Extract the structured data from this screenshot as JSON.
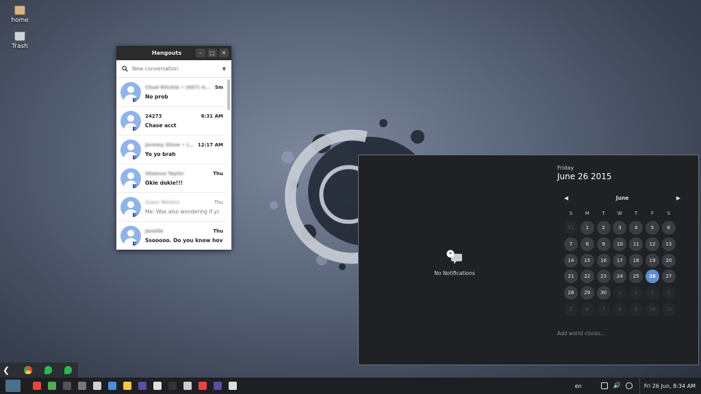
{
  "desktop": {
    "icons": [
      {
        "label": "home",
        "icon": "folder-icon"
      },
      {
        "label": "Trash",
        "icon": "trash-icon"
      }
    ]
  },
  "hangouts": {
    "title": "Hangouts",
    "search_placeholder": "New conversation",
    "conversations": [
      {
        "name": "Chad Ritchie • (607) 4...",
        "time": "5m",
        "message": "No prob",
        "blurred": true,
        "read": false
      },
      {
        "name": "24273",
        "time": "6:31 AM",
        "message": "Chase acct",
        "blurred": false,
        "read": false
      },
      {
        "name": "Jeremy Shaw • (6...",
        "time": "12:17 AM",
        "message": "Yo yo brah",
        "blurred": true,
        "read": false
      },
      {
        "name": "Shamsa Taylor",
        "time": "Thu",
        "message": "Okie dokie!!!",
        "blurred": true,
        "read": false
      },
      {
        "name": "Susan Winters",
        "time": "Thu",
        "message": "Me: Was also wondering if yc",
        "blurred": true,
        "read": true
      },
      {
        "name": "Janelle",
        "time": "Thu",
        "message": "Ssooooo. Do you know hov",
        "blurred": true,
        "read": false
      }
    ],
    "badge": "SMS"
  },
  "notifications": {
    "empty_label": "No Notifications"
  },
  "calendar": {
    "weekday": "Friday",
    "date_full": "June 26 2015",
    "month": "June",
    "weekday_initials": [
      "S",
      "M",
      "T",
      "W",
      "T",
      "F",
      "S"
    ],
    "days": [
      {
        "d": "31",
        "other": true
      },
      {
        "d": "1"
      },
      {
        "d": "2"
      },
      {
        "d": "3"
      },
      {
        "d": "4"
      },
      {
        "d": "5"
      },
      {
        "d": "6"
      },
      {
        "d": "7"
      },
      {
        "d": "8"
      },
      {
        "d": "9"
      },
      {
        "d": "10"
      },
      {
        "d": "11"
      },
      {
        "d": "12"
      },
      {
        "d": "13"
      },
      {
        "d": "14"
      },
      {
        "d": "15"
      },
      {
        "d": "16"
      },
      {
        "d": "17"
      },
      {
        "d": "18"
      },
      {
        "d": "19"
      },
      {
        "d": "20"
      },
      {
        "d": "21"
      },
      {
        "d": "22"
      },
      {
        "d": "23"
      },
      {
        "d": "24"
      },
      {
        "d": "25"
      },
      {
        "d": "26",
        "today": true
      },
      {
        "d": "27"
      },
      {
        "d": "28"
      },
      {
        "d": "29"
      },
      {
        "d": "30"
      },
      {
        "d": "1",
        "other": true
      },
      {
        "d": "2",
        "other": true
      },
      {
        "d": "3",
        "other": true
      },
      {
        "d": "4",
        "other": true
      },
      {
        "d": "5",
        "other": true
      },
      {
        "d": "6",
        "other": true
      },
      {
        "d": "7",
        "other": true
      },
      {
        "d": "8",
        "other": true
      },
      {
        "d": "9",
        "other": true
      },
      {
        "d": "10",
        "other": true
      },
      {
        "d": "11",
        "other": true
      }
    ],
    "world_clocks_link": "Add world clocks..."
  },
  "minidock": {
    "icons": [
      "chrome-icon",
      "hangouts-icon",
      "hangouts-icon"
    ]
  },
  "taskbar": {
    "apps": [
      {
        "icon": "chrome-icon",
        "color": "#e8453c"
      },
      {
        "icon": "image-viewer-icon",
        "color": "#4caf50"
      },
      {
        "icon": "bird-icon",
        "color": "#555555"
      },
      {
        "icon": "eagle-icon",
        "color": "#777777"
      },
      {
        "icon": "camera-icon",
        "color": "#d0d0d0"
      },
      {
        "icon": "document-icon",
        "color": "#4a90d9"
      },
      {
        "icon": "text-editor-icon",
        "color": "#f4c542"
      },
      {
        "icon": "eclipse-icon",
        "color": "#5c4ea3"
      },
      {
        "icon": "file-icon",
        "color": "#e0e0e0"
      },
      {
        "icon": "terminal-icon",
        "color": "#333333"
      },
      {
        "icon": "calculator-icon",
        "color": "#cccccc"
      },
      {
        "icon": "chrome-icon",
        "color": "#e8453c"
      },
      {
        "icon": "eclipse-icon",
        "color": "#5c4ea3"
      },
      {
        "icon": "search-icon",
        "color": "#dddddd"
      }
    ],
    "language": "en",
    "clock": "Fri 26 Jun,  8:34 AM"
  }
}
